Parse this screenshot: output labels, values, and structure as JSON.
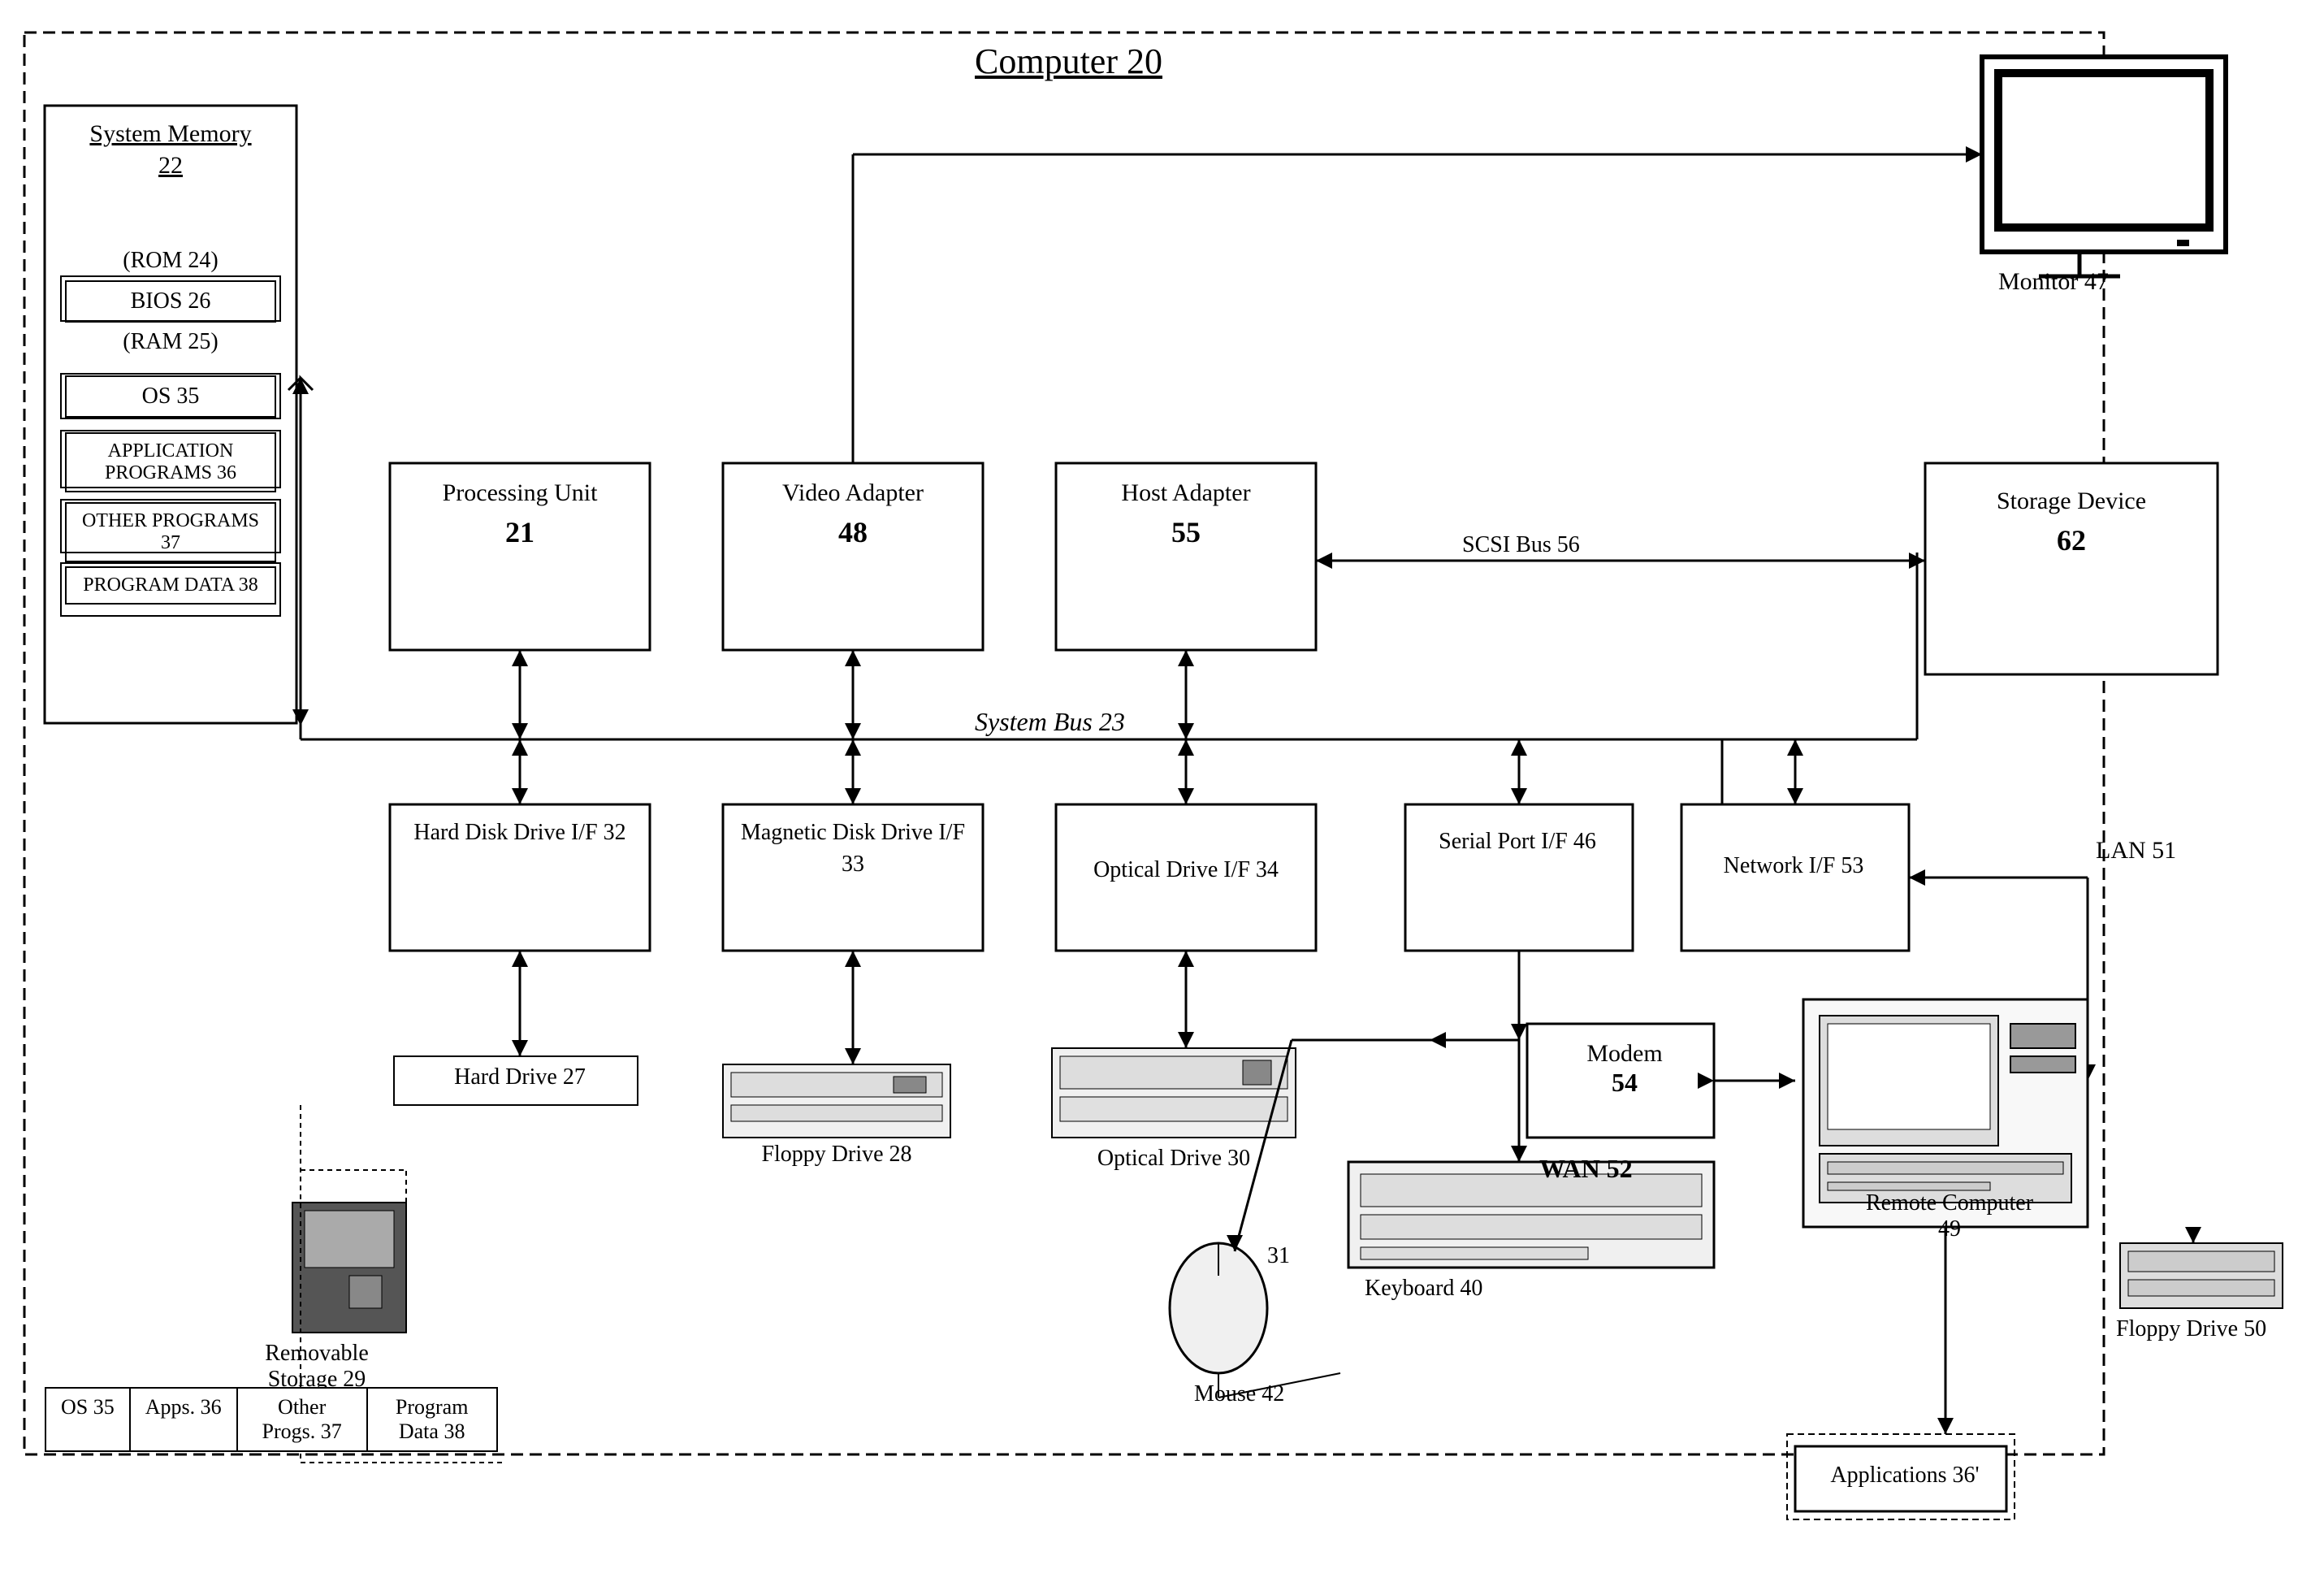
{
  "title": "Computer 20",
  "components": {
    "system_memory": {
      "label": "System Memory",
      "number": "22",
      "rom": "(ROM 24)",
      "bios": "BIOS 26",
      "ram": "(RAM 25)",
      "os": "OS 35",
      "app_programs": "APPLICATION PROGRAMS 36",
      "other_programs": "OTHER PROGRAMS 37",
      "program_data": "PROGRAM DATA 38"
    },
    "processing_unit": {
      "label": "Processing Unit",
      "number": "21"
    },
    "video_adapter": {
      "label": "Video Adapter",
      "number": "48"
    },
    "host_adapter": {
      "label": "Host Adapter",
      "number": "55"
    },
    "storage_device": {
      "label": "Storage Device",
      "number": "62"
    },
    "monitor": {
      "label": "Monitor 47"
    },
    "hard_disk_if": {
      "label": "Hard Disk Drive I/F 32"
    },
    "magnetic_disk_if": {
      "label": "Magnetic Disk Drive I/F 33"
    },
    "optical_drive_if": {
      "label": "Optical Drive I/F 34"
    },
    "serial_port_if": {
      "label": "Serial Port I/F 46"
    },
    "network_if": {
      "label": "Network I/F 53"
    },
    "hard_drive": {
      "label": "Hard Drive 27"
    },
    "floppy_drive": {
      "label": "Floppy Drive 28"
    },
    "removable_storage": {
      "label": "Removable Storage 29"
    },
    "optical_drive": {
      "label": "Optical Drive 30"
    },
    "mouse": {
      "label": "31"
    },
    "mouse_label": {
      "label": "Mouse 42"
    },
    "keyboard": {
      "label": "Keyboard 40"
    },
    "modem": {
      "label": "Modem",
      "number": "54"
    },
    "wan": {
      "label": "WAN 52"
    },
    "remote_computer": {
      "label": "Remote Computer",
      "number": "49"
    },
    "floppy_drive_50": {
      "label": "Floppy Drive 50"
    },
    "applications_36": {
      "label": "Applications 36'"
    },
    "system_bus": {
      "label": "System Bus 23"
    },
    "scsi_bus": {
      "label": "SCSI Bus 56"
    },
    "lan": {
      "label": "LAN 51"
    }
  },
  "bottom_items": {
    "os": "OS 35",
    "apps": "Apps. 36",
    "other_progs": "Other Progs. 37",
    "program_data": "Program Data 38"
  }
}
